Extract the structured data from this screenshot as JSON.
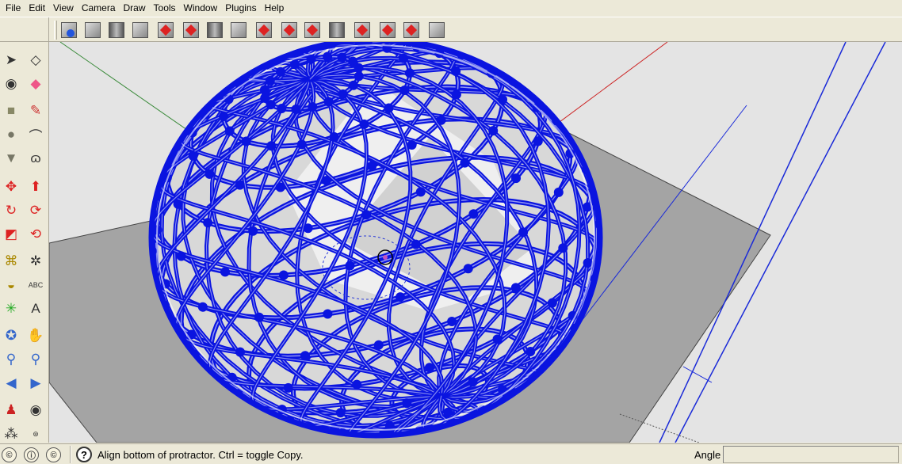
{
  "menu": [
    "File",
    "Edit",
    "View",
    "Camera",
    "Draw",
    "Tools",
    "Window",
    "Plugins",
    "Help"
  ],
  "toolbar_icons": [
    "bucket-paint-icon",
    "hatch-icon",
    "column-icon",
    "wall-icon",
    "rotate-red-icon",
    "explode-red-icon",
    "curve-surface-icon",
    "door-icon",
    "arc-red-icon",
    "move-red-icon",
    "pencil-pink-icon",
    "frame-icon",
    "bend-red-icon",
    "star-red-icon",
    "eraser-pink-icon",
    "scroll-icon"
  ],
  "palette_tools": [
    [
      "select-icon",
      "eraser-icon"
    ],
    [
      "paint-bucket-icon",
      "eraser-pink-icon"
    ],
    [
      "rectangle-icon",
      "pencil-icon"
    ],
    [
      "circle-icon",
      "arc-icon"
    ],
    [
      "polygon-icon",
      "freehand-icon"
    ],
    [
      "move-icon",
      "push-pull-icon"
    ],
    [
      "rotate-icon",
      "follow-me-icon"
    ],
    [
      "scale-icon",
      "offset-icon"
    ],
    [
      "tape-measure-icon",
      "dimension-icon"
    ],
    [
      "protractor-icon",
      "text-icon"
    ],
    [
      "axes-icon",
      "3d-text-icon"
    ],
    [
      "orbit-icon",
      "pan-icon"
    ],
    [
      "zoom-icon",
      "zoom-extents-icon"
    ],
    [
      "previous-view-icon",
      "next-view-icon"
    ],
    [
      "position-camera-icon",
      "look-around-icon"
    ],
    [
      "walk-icon",
      "section-plane-icon"
    ]
  ],
  "status": {
    "text": "Align bottom of protractor.  Ctrl = toggle Copy.",
    "angle_label": "Angle",
    "angle_value": ""
  },
  "colors": {
    "frame_blue": "#0a14e0",
    "ground_gray": "#a4a4a4",
    "sky": "#e4e4e4"
  }
}
